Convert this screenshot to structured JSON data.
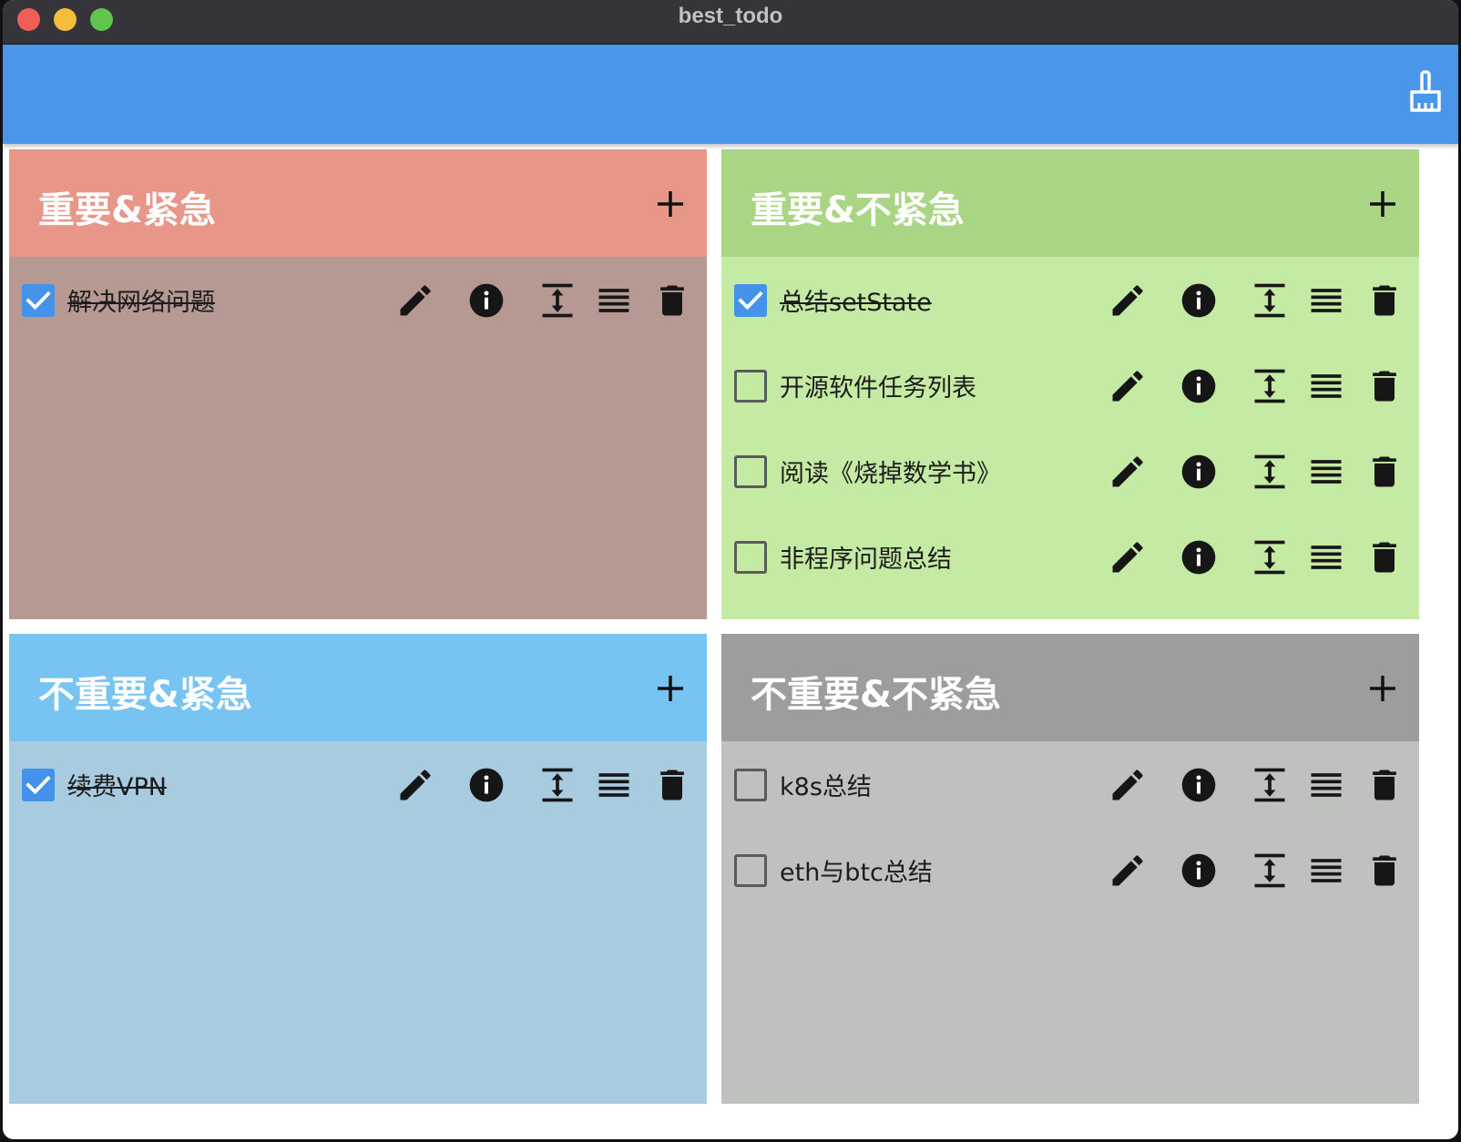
{
  "window": {
    "title": "best_todo"
  },
  "toolbar": {
    "clear_icon": "broom-icon"
  },
  "quadrants": [
    {
      "title": "重要&紧急",
      "header_color": "#e79687",
      "body_color": "#b69993",
      "items": [
        {
          "label": "解决网络问题",
          "done": true
        }
      ]
    },
    {
      "title": "重要&不紧急",
      "header_color": "#aad584",
      "body_color": "#c5eaa4",
      "items": [
        {
          "label": "总结setState",
          "done": true
        },
        {
          "label": "开源软件任务列表",
          "done": false
        },
        {
          "label": "阅读《烧掉数学书》",
          "done": false
        },
        {
          "label": "非程序问题总结",
          "done": false
        }
      ]
    },
    {
      "title": "不重要&紧急",
      "header_color": "#77c3f2",
      "body_color": "#a8cbe0",
      "items": [
        {
          "label": "续费VPN",
          "done": true
        }
      ]
    },
    {
      "title": "不重要&不紧急",
      "header_color": "#9c9e9c",
      "body_color": "#bfc1be",
      "items": [
        {
          "label": "k8s总结",
          "done": false
        },
        {
          "label": "eth与btc总结",
          "done": false
        }
      ]
    }
  ],
  "icons": {
    "add": "plus-icon",
    "edit": "pencil-icon",
    "info": "info-icon",
    "move": "vertical-align-icon",
    "detail": "list-lines-icon",
    "delete": "trash-icon",
    "checked": "checkbox-checked-icon",
    "unchecked": "checkbox-unchecked-icon"
  }
}
